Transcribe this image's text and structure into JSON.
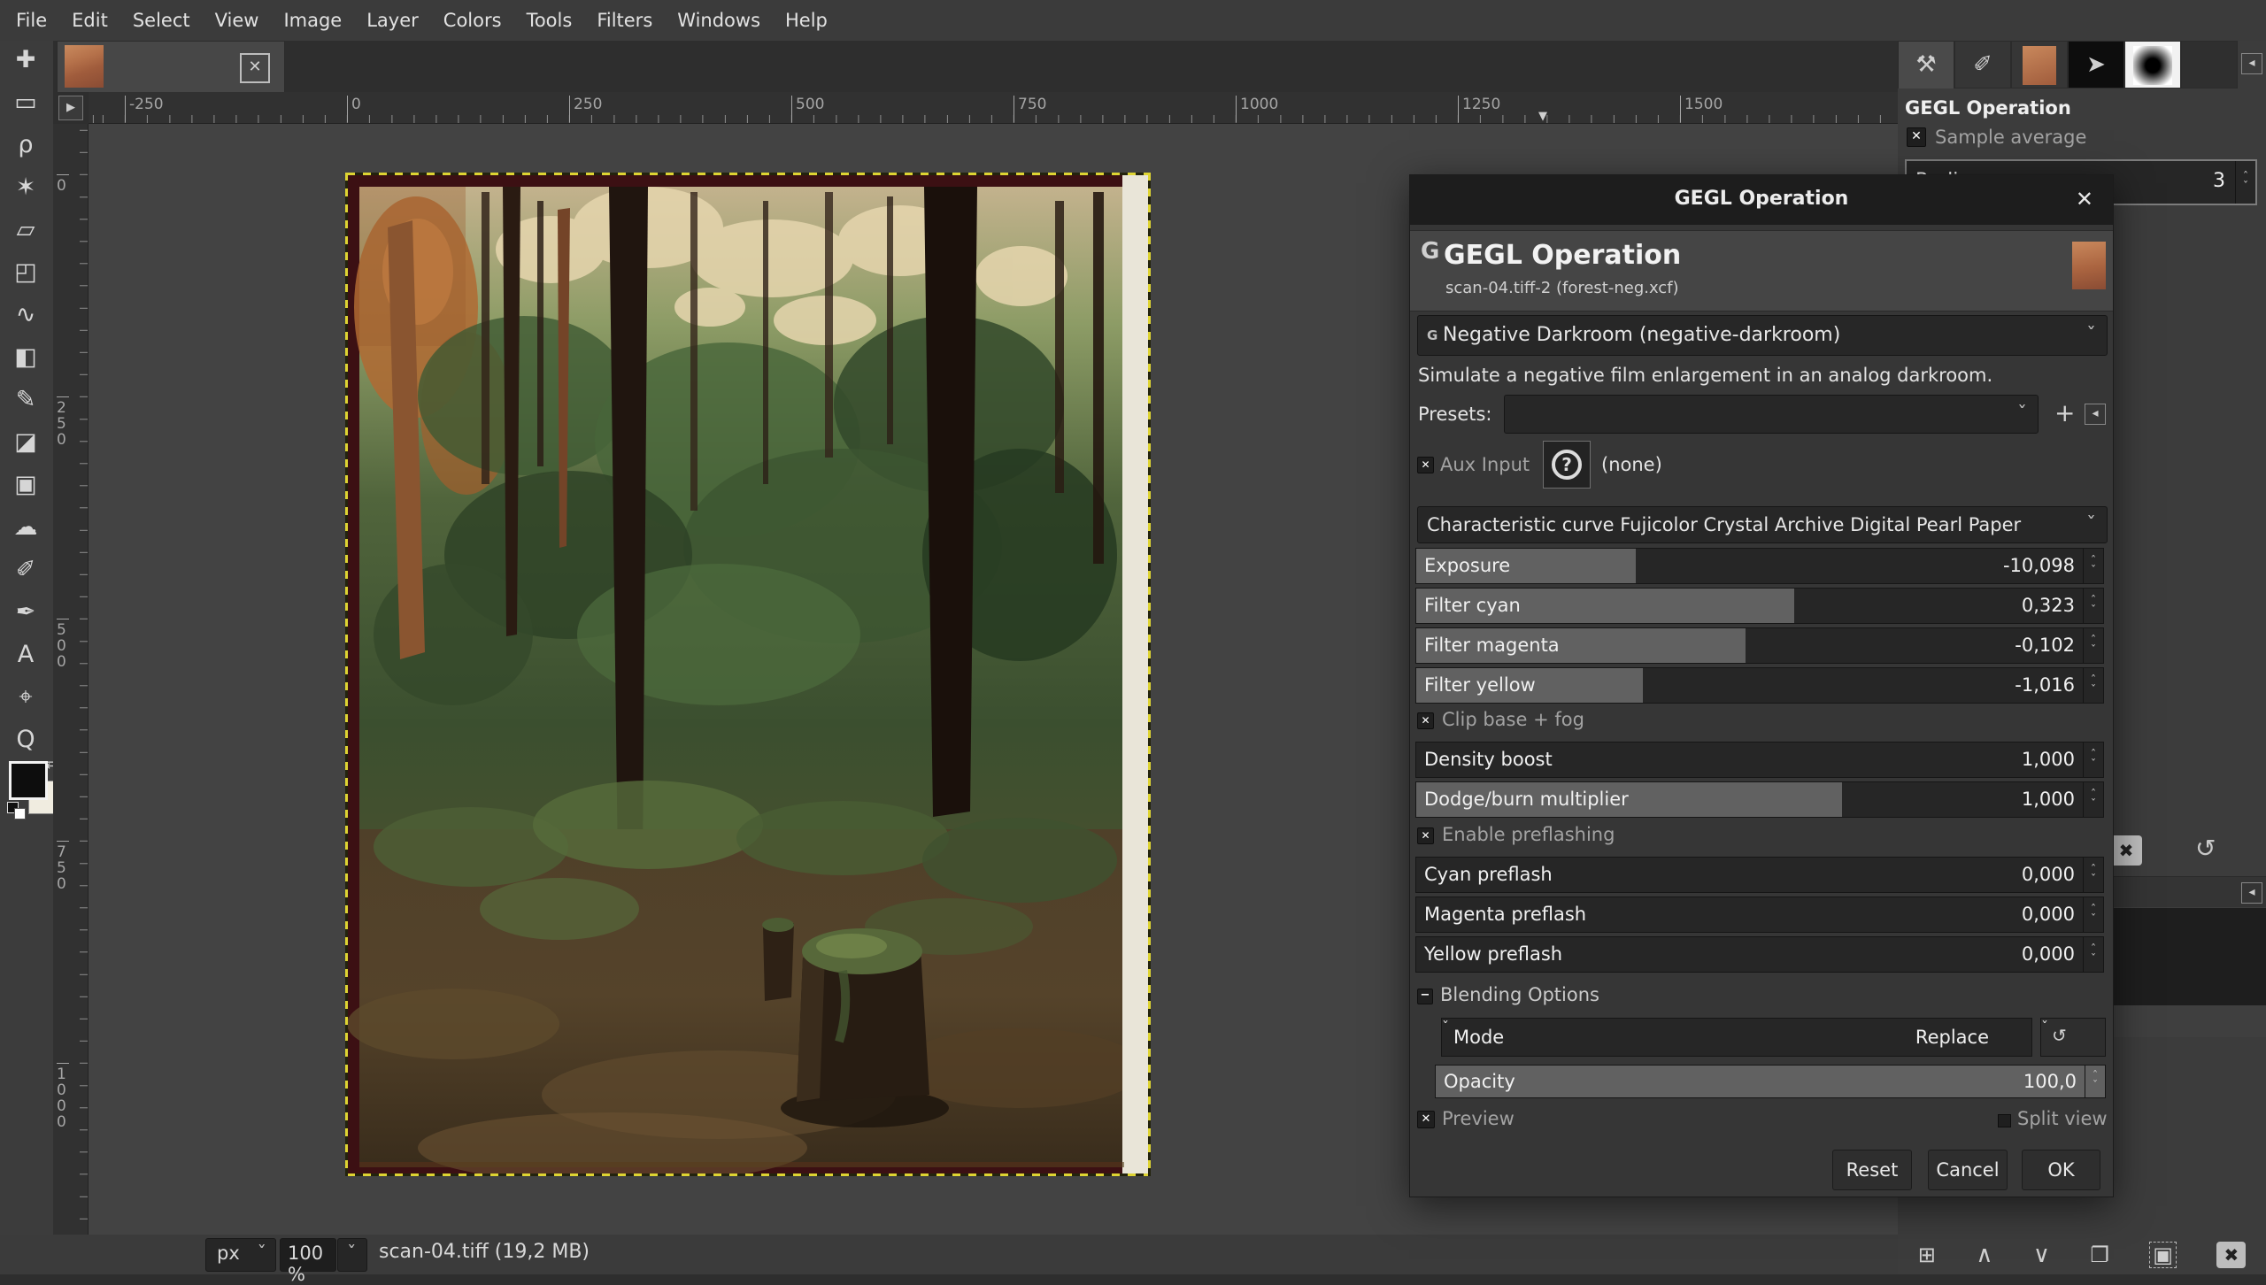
{
  "menu": {
    "items": [
      "File",
      "Edit",
      "Select",
      "View",
      "Image",
      "Layer",
      "Colors",
      "Tools",
      "Filters",
      "Windows",
      "Help"
    ]
  },
  "toolbox": {
    "tools": [
      {
        "name": "move-tool",
        "glyph": "✚"
      },
      {
        "name": "rectangle-select-tool",
        "glyph": "▭"
      },
      {
        "name": "free-select-tool",
        "glyph": "ρ"
      },
      {
        "name": "fuzzy-select-tool",
        "glyph": "✶"
      },
      {
        "name": "crop-tool",
        "glyph": "▱"
      },
      {
        "name": "transform-tool",
        "glyph": "◰"
      },
      {
        "name": "warp-tool",
        "glyph": "∿"
      },
      {
        "name": "bucket-fill-tool",
        "glyph": "◧"
      },
      {
        "name": "paintbrush-tool",
        "glyph": "✎"
      },
      {
        "name": "eraser-tool",
        "glyph": "◪"
      },
      {
        "name": "clone-tool",
        "glyph": "▣"
      },
      {
        "name": "smudge-tool",
        "glyph": "☁"
      },
      {
        "name": "ink-tool",
        "glyph": "✐"
      },
      {
        "name": "paths-tool",
        "glyph": "✒"
      },
      {
        "name": "text-tool",
        "glyph": "A"
      },
      {
        "name": "color-picker-tool",
        "glyph": "⌖"
      },
      {
        "name": "zoom-tool",
        "glyph": "Q"
      }
    ]
  },
  "image_tab": {
    "close_icon": "✕"
  },
  "rulers": {
    "top": [
      "-250",
      "0",
      "250",
      "500",
      "750",
      "1000",
      "1250",
      "1500"
    ],
    "left": [
      "0",
      "250",
      "500",
      "750",
      "1000"
    ]
  },
  "dialog": {
    "title": "GEGL Operation",
    "header": {
      "badge": "G",
      "title": "GEGL Operation",
      "subtitle": "scan-04.tiff-2 (forest-neg.xcf)"
    },
    "operation_combo": {
      "badge": "G",
      "label": "Negative Darkroom (negative-darkroom)"
    },
    "description": "Simulate a negative film enlargement in an analog darkroom.",
    "presets_label": "Presets:",
    "aux": {
      "label": "Aux Input",
      "value": "(none)"
    },
    "curve_combo": "Characteristic curve Fujicolor Crystal Archive Digital Pearl Paper",
    "sliders": [
      {
        "label": "Exposure",
        "value": "-10,098",
        "fill": 32
      },
      {
        "label": "Filter cyan",
        "value": "0,323",
        "fill": 55
      },
      {
        "label": "Filter magenta",
        "value": "-0,102",
        "fill": 48
      },
      {
        "label": "Filter yellow",
        "value": "-1,016",
        "fill": 33
      },
      {
        "label": "Density boost",
        "value": "1,000",
        "fill": 0
      },
      {
        "label": "Dodge/burn multiplier",
        "value": "1,000",
        "fill": 62
      },
      {
        "label": "Cyan preflash",
        "value": "0,000",
        "fill": 0
      },
      {
        "label": "Magenta preflash",
        "value": "0,000",
        "fill": 0
      },
      {
        "label": "Yellow preflash",
        "value": "0,000",
        "fill": 0
      },
      {
        "label": "Opacity",
        "value": "100,0",
        "fill": 100
      }
    ],
    "checks": {
      "clip": "Clip base + fog",
      "preflash": "Enable preflashing",
      "preview": "Preview",
      "split": "Split view"
    },
    "blending": {
      "section": "Blending Options",
      "mode_label": "Mode",
      "mode_value": "Replace"
    },
    "buttons": {
      "reset": "Reset",
      "cancel": "Cancel",
      "ok": "OK"
    }
  },
  "dock": {
    "title": "GEGL Operation",
    "sample_average": "Sample average",
    "radius": {
      "label": "Radius",
      "value": "3"
    }
  },
  "statusbar": {
    "unit": "px",
    "zoom": "100 %",
    "title": "scan-04.tiff (19,2 MB)"
  },
  "icons": {
    "chevron_down": "ˇ",
    "spin_up": "ˆ",
    "spin_down": "ˇ",
    "check": "✕",
    "plus": "+",
    "panel_arrow": "◂",
    "close": "✖",
    "help": "?",
    "expander_minus": "−",
    "mode_cycle": "↺",
    "ruler_marker": "▼",
    "corner_play": "▶",
    "swap": "⇄",
    "pointer": "➤",
    "tool_options_tab": "⚒",
    "device_status_tab": "✐",
    "new_layer": "⊞",
    "raise": "∧",
    "lower": "∨",
    "duplicate": "❐",
    "mask": "▣",
    "delete": "✖",
    "reset_tool": "↺"
  }
}
